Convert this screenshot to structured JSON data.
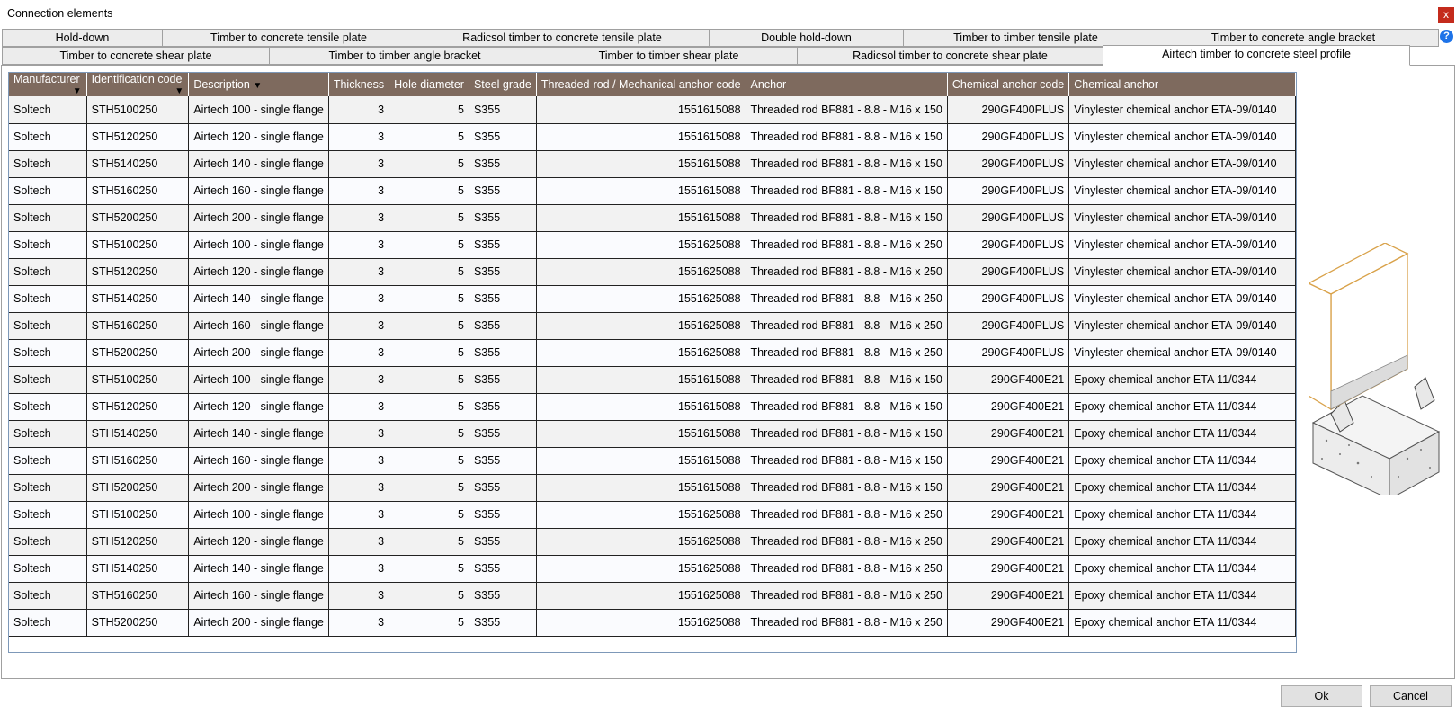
{
  "window": {
    "title": "Connection elements",
    "close_glyph": "x"
  },
  "tabs_row1": [
    "Hold-down",
    "Timber to concrete tensile plate",
    "Radicsol timber to concrete tensile plate",
    "Double hold-down",
    "Timber to timber tensile plate",
    "Timber to concrete angle bracket"
  ],
  "tabs_row2": [
    "Timber to concrete shear plate",
    "Timber to timber angle bracket",
    "Timber to timber shear plate",
    "Radicsol timber to concrete shear plate",
    "Airtech timber to concrete steel profile"
  ],
  "active_tab": "Airtech timber to concrete steel profile",
  "help_glyph": "?",
  "filter_glyph": "▼",
  "table": {
    "columns": [
      "Manufacturer",
      "Identification code",
      "Description",
      "Thickness",
      "Hole diameter",
      "Steel grade",
      "Threaded-rod / Mechanical anchor code",
      "Anchor",
      "Chemical anchor code",
      "Chemical anchor"
    ],
    "rows": [
      [
        "Soltech",
        "STH5100250",
        "Airtech 100 - single flange",
        "3",
        "5",
        "S355",
        "1551615088",
        "Threaded rod BF881 - 8.8 - M16 x 150",
        "290GF400PLUS",
        "Vinylester chemical anchor ETA-09/0140"
      ],
      [
        "Soltech",
        "STH5120250",
        "Airtech 120 - single flange",
        "3",
        "5",
        "S355",
        "1551615088",
        "Threaded rod BF881 - 8.8 - M16 x 150",
        "290GF400PLUS",
        "Vinylester chemical anchor ETA-09/0140"
      ],
      [
        "Soltech",
        "STH5140250",
        "Airtech 140 - single flange",
        "3",
        "5",
        "S355",
        "1551615088",
        "Threaded rod BF881 - 8.8 - M16 x 150",
        "290GF400PLUS",
        "Vinylester chemical anchor ETA-09/0140"
      ],
      [
        "Soltech",
        "STH5160250",
        "Airtech 160 - single flange",
        "3",
        "5",
        "S355",
        "1551615088",
        "Threaded rod BF881 - 8.8 - M16 x 150",
        "290GF400PLUS",
        "Vinylester chemical anchor ETA-09/0140"
      ],
      [
        "Soltech",
        "STH5200250",
        "Airtech 200 - single flange",
        "3",
        "5",
        "S355",
        "1551615088",
        "Threaded rod BF881 - 8.8 - M16 x 150",
        "290GF400PLUS",
        "Vinylester chemical anchor ETA-09/0140"
      ],
      [
        "Soltech",
        "STH5100250",
        "Airtech 100 - single flange",
        "3",
        "5",
        "S355",
        "1551625088",
        "Threaded rod BF881 - 8.8 - M16 x 250",
        "290GF400PLUS",
        "Vinylester chemical anchor ETA-09/0140"
      ],
      [
        "Soltech",
        "STH5120250",
        "Airtech 120 - single flange",
        "3",
        "5",
        "S355",
        "1551625088",
        "Threaded rod BF881 - 8.8 - M16 x 250",
        "290GF400PLUS",
        "Vinylester chemical anchor ETA-09/0140"
      ],
      [
        "Soltech",
        "STH5140250",
        "Airtech 140 - single flange",
        "3",
        "5",
        "S355",
        "1551625088",
        "Threaded rod BF881 - 8.8 - M16 x 250",
        "290GF400PLUS",
        "Vinylester chemical anchor ETA-09/0140"
      ],
      [
        "Soltech",
        "STH5160250",
        "Airtech 160 - single flange",
        "3",
        "5",
        "S355",
        "1551625088",
        "Threaded rod BF881 - 8.8 - M16 x 250",
        "290GF400PLUS",
        "Vinylester chemical anchor ETA-09/0140"
      ],
      [
        "Soltech",
        "STH5200250",
        "Airtech 200 - single flange",
        "3",
        "5",
        "S355",
        "1551625088",
        "Threaded rod BF881 - 8.8 - M16 x 250",
        "290GF400PLUS",
        "Vinylester chemical anchor ETA-09/0140"
      ],
      [
        "Soltech",
        "STH5100250",
        "Airtech 100 - single flange",
        "3",
        "5",
        "S355",
        "1551615088",
        "Threaded rod BF881 - 8.8 - M16 x 150",
        "290GF400E21",
        "Epoxy chemical anchor ETA 11/0344"
      ],
      [
        "Soltech",
        "STH5120250",
        "Airtech 120 - single flange",
        "3",
        "5",
        "S355",
        "1551615088",
        "Threaded rod BF881 - 8.8 - M16 x 150",
        "290GF400E21",
        "Epoxy chemical anchor ETA 11/0344"
      ],
      [
        "Soltech",
        "STH5140250",
        "Airtech 140 - single flange",
        "3",
        "5",
        "S355",
        "1551615088",
        "Threaded rod BF881 - 8.8 - M16 x 150",
        "290GF400E21",
        "Epoxy chemical anchor ETA 11/0344"
      ],
      [
        "Soltech",
        "STH5160250",
        "Airtech 160 - single flange",
        "3",
        "5",
        "S355",
        "1551615088",
        "Threaded rod BF881 - 8.8 - M16 x 150",
        "290GF400E21",
        "Epoxy chemical anchor ETA 11/0344"
      ],
      [
        "Soltech",
        "STH5200250",
        "Airtech 200 - single flange",
        "3",
        "5",
        "S355",
        "1551615088",
        "Threaded rod BF881 - 8.8 - M16 x 150",
        "290GF400E21",
        "Epoxy chemical anchor ETA 11/0344"
      ],
      [
        "Soltech",
        "STH5100250",
        "Airtech 100 - single flange",
        "3",
        "5",
        "S355",
        "1551625088",
        "Threaded rod BF881 - 8.8 - M16 x 250",
        "290GF400E21",
        "Epoxy chemical anchor ETA 11/0344"
      ],
      [
        "Soltech",
        "STH5120250",
        "Airtech 120 - single flange",
        "3",
        "5",
        "S355",
        "1551625088",
        "Threaded rod BF881 - 8.8 - M16 x 250",
        "290GF400E21",
        "Epoxy chemical anchor ETA 11/0344"
      ],
      [
        "Soltech",
        "STH5140250",
        "Airtech 140 - single flange",
        "3",
        "5",
        "S355",
        "1551625088",
        "Threaded rod BF881 - 8.8 - M16 x 250",
        "290GF400E21",
        "Epoxy chemical anchor ETA 11/0344"
      ],
      [
        "Soltech",
        "STH5160250",
        "Airtech 160 - single flange",
        "3",
        "5",
        "S355",
        "1551625088",
        "Threaded rod BF881 - 8.8 - M16 x 250",
        "290GF400E21",
        "Epoxy chemical anchor ETA 11/0344"
      ],
      [
        "Soltech",
        "STH5200250",
        "Airtech 200 - single flange",
        "3",
        "5",
        "S355",
        "1551625088",
        "Threaded rod BF881 - 8.8 - M16 x 250",
        "290GF400E21",
        "Epoxy chemical anchor ETA 11/0344"
      ]
    ]
  },
  "colors": {
    "header_bg": "#7e6a5e",
    "close_bg": "#c42b1c",
    "help_bg": "#1e73e8",
    "timber_outline": "#d9a24a"
  },
  "buttons": {
    "ok": "Ok",
    "cancel": "Cancel"
  }
}
